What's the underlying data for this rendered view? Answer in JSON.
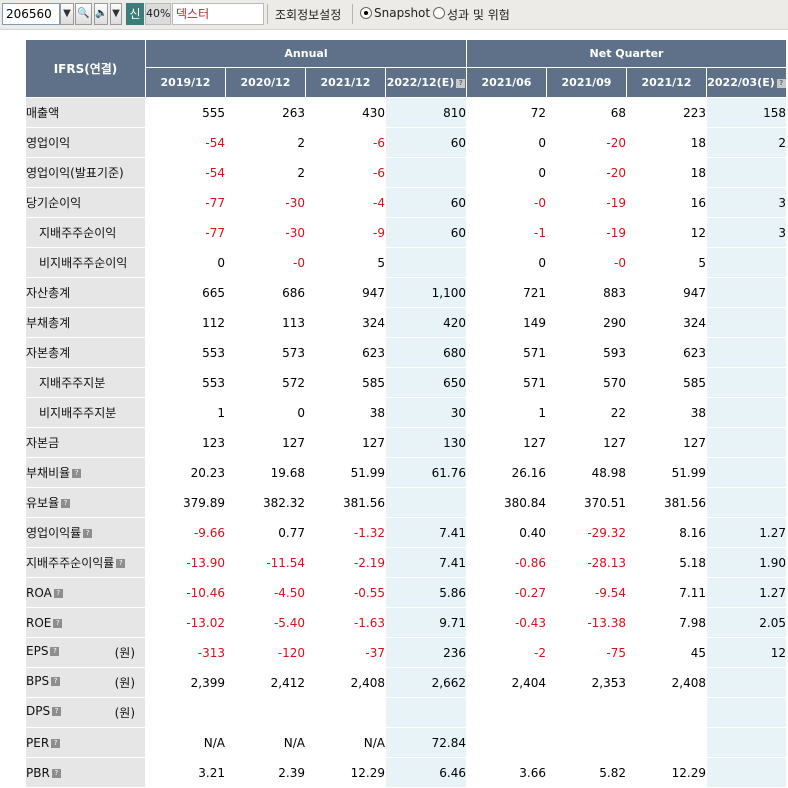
{
  "toolbar": {
    "stock_code": "206560",
    "dropdown_glyph": "▼",
    "search_glyph": "🔍",
    "speaker_glyph": "🔈",
    "speaker_dropdown_glyph": "▼",
    "badge": "신",
    "percent": "40%",
    "company_name": "덱스터",
    "settings_label": "조회정보설정",
    "radio_snapshot": "Snapshot",
    "radio_performance": "성과 및 위험",
    "selected": "Snapshot"
  },
  "table": {
    "corner_label": "IFRS(연결)",
    "annual_label": "Annual",
    "quarter_label": "Net Quarter",
    "question_mark": "?",
    "periods": [
      "2019/12",
      "2020/12",
      "2021/12",
      "2022/12(E)",
      "2021/06",
      "2021/09",
      "2021/12",
      "2022/03(E)"
    ],
    "rows": [
      {
        "label": "매출액",
        "values": [
          "555",
          "263",
          "430",
          "810",
          "72",
          "68",
          "223",
          "158"
        ]
      },
      {
        "label": "영업이익",
        "values": [
          "-54",
          "2",
          "-6",
          "60",
          "0",
          "-20",
          "18",
          "2"
        ]
      },
      {
        "label": "영업이익(발표기준)",
        "values": [
          "-54",
          "2",
          "-6",
          "",
          "0",
          "-20",
          "18",
          ""
        ]
      },
      {
        "label": "당기순이익",
        "values": [
          "-77",
          "-30",
          "-4",
          "60",
          "-0",
          "-19",
          "16",
          "3"
        ]
      },
      {
        "label": "지배주주순이익",
        "values": [
          "-77",
          "-30",
          "-9",
          "60",
          "-1",
          "-19",
          "12",
          "3"
        ]
      },
      {
        "label": "비지배주주순이익",
        "values": [
          "0",
          "-0",
          "5",
          "",
          "0",
          "-0",
          "5",
          ""
        ]
      },
      {
        "label": "자산총계",
        "values": [
          "665",
          "686",
          "947",
          "1,100",
          "721",
          "883",
          "947",
          ""
        ]
      },
      {
        "label": "부채총계",
        "values": [
          "112",
          "113",
          "324",
          "420",
          "149",
          "290",
          "324",
          ""
        ]
      },
      {
        "label": "자본총계",
        "values": [
          "553",
          "573",
          "623",
          "680",
          "571",
          "593",
          "623",
          ""
        ]
      },
      {
        "label": "지배주주지분",
        "values": [
          "553",
          "572",
          "585",
          "650",
          "571",
          "570",
          "585",
          ""
        ]
      },
      {
        "label": "비지배주주지분",
        "values": [
          "1",
          "0",
          "38",
          "30",
          "1",
          "22",
          "38",
          ""
        ]
      },
      {
        "label": "자본금",
        "values": [
          "123",
          "127",
          "127",
          "130",
          "127",
          "127",
          "127",
          ""
        ]
      },
      {
        "label": "부채비율",
        "unit": "",
        "values": [
          "20.23",
          "19.68",
          "51.99",
          "61.76",
          "26.16",
          "48.98",
          "51.99",
          ""
        ]
      },
      {
        "label": "유보율",
        "unit": "",
        "values": [
          "379.89",
          "382.32",
          "381.56",
          "",
          "380.84",
          "370.51",
          "381.56",
          ""
        ]
      },
      {
        "label": "영업이익률",
        "unit": "",
        "values": [
          "-9.66",
          "0.77",
          "-1.32",
          "7.41",
          "0.40",
          "-29.32",
          "8.16",
          "1.27"
        ]
      },
      {
        "label": "지배주주순이익률",
        "unit": "",
        "values": [
          "-13.90",
          "-11.54",
          "-2.19",
          "7.41",
          "-0.86",
          "-28.13",
          "5.18",
          "1.90"
        ]
      },
      {
        "label": "ROA",
        "unit": "",
        "values": [
          "-10.46",
          "-4.50",
          "-0.55",
          "5.86",
          "-0.27",
          "-9.54",
          "7.11",
          "1.27"
        ]
      },
      {
        "label": "ROE",
        "unit": "",
        "values": [
          "-13.02",
          "-5.40",
          "-1.63",
          "9.71",
          "-0.43",
          "-13.38",
          "7.98",
          "2.05"
        ]
      },
      {
        "label": "EPS",
        "unit": "(원)",
        "values": [
          "-313",
          "-120",
          "-37",
          "236",
          "-2",
          "-75",
          "45",
          "12"
        ]
      },
      {
        "label": "BPS",
        "unit": "(원)",
        "values": [
          "2,399",
          "2,412",
          "2,408",
          "2,662",
          "2,404",
          "2,353",
          "2,408",
          ""
        ]
      },
      {
        "label": "DPS",
        "unit": "(원)",
        "values": [
          "",
          "",
          "",
          "",
          "",
          "",
          "",
          ""
        ]
      },
      {
        "label": "PER",
        "unit": "",
        "values": [
          "N/A",
          "N/A",
          "N/A",
          "72.84",
          "",
          "",
          "",
          ""
        ]
      },
      {
        "label": "PBR",
        "unit": "",
        "values": [
          "3.21",
          "2.39",
          "12.29",
          "6.46",
          "3.66",
          "5.82",
          "12.29",
          ""
        ]
      }
    ]
  },
  "colors": {
    "header_bg": "#5f7188",
    "label_bg": "#e6e6e6",
    "estimate_bg": "#e8f3f8",
    "negative": "#d4121b",
    "badge_bg": "#3d7d79"
  }
}
